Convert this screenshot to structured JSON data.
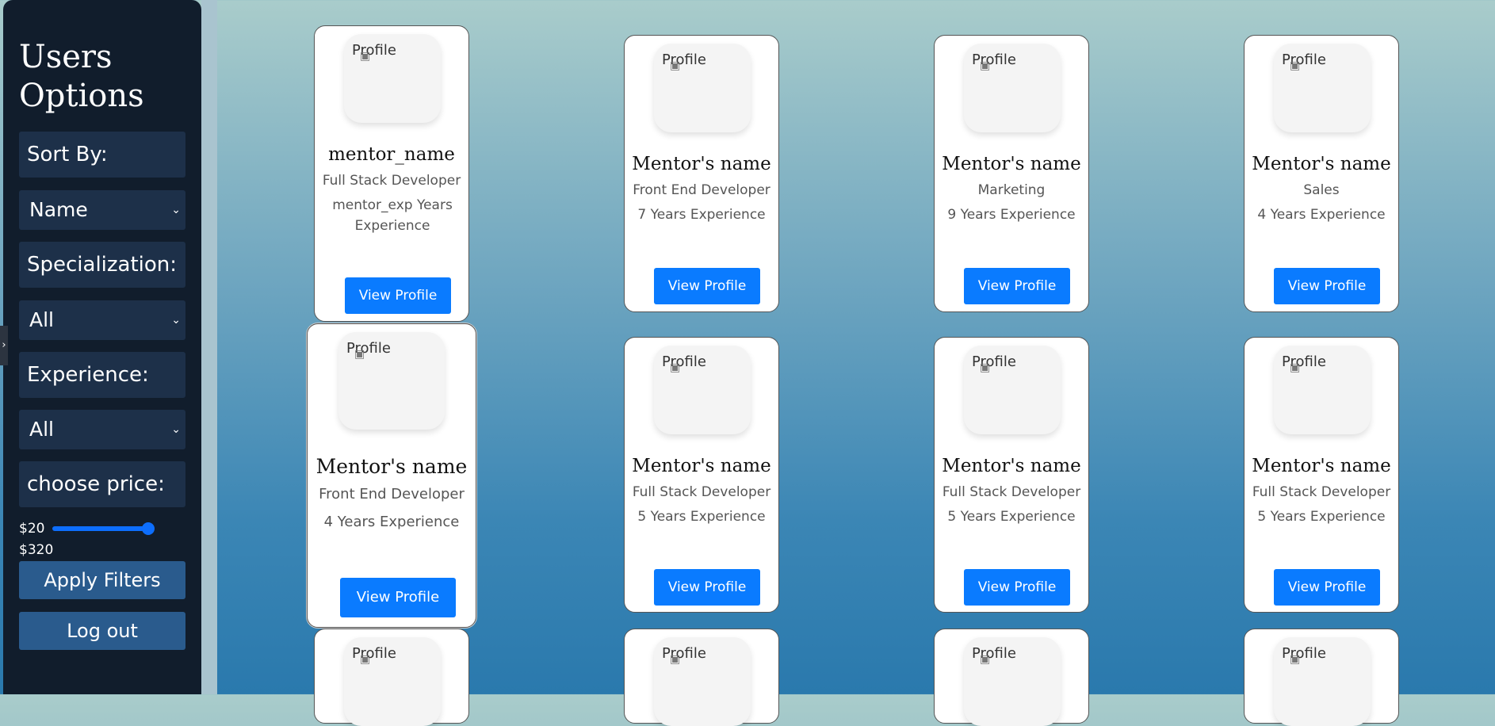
{
  "sidebar": {
    "title": "Users Options",
    "sort_label": "Sort By:",
    "sort_value": "Name",
    "specialization_label": "Specialization:",
    "specialization_value": "All",
    "experience_label": "Experience:",
    "experience_value": "All",
    "price_label": "choose price:",
    "price_min": "$20",
    "price_max": "$320",
    "apply_label": "Apply Filters",
    "logout_label": "Log out"
  },
  "icons": {
    "chevron": "chevron-down-icon",
    "broken_image": "broken-image-icon"
  },
  "colors": {
    "sidebar": "#111d2c",
    "field": "#1d3049",
    "button_dark": "#2a5b8d",
    "accent": "#0a7bff"
  },
  "cards": [
    {
      "alt": "Profile",
      "name": "mentor_name",
      "role": "Full Stack Developer",
      "exp": "mentor_exp Years Experience",
      "button": "View Profile"
    },
    {
      "alt": "Profile",
      "name": "Mentor's name",
      "role": "Front End Developer",
      "exp": "7 Years Experience",
      "button": "View Profile"
    },
    {
      "alt": "Profile",
      "name": "Mentor's name",
      "role": "Marketing",
      "exp": "9 Years Experience",
      "button": "View Profile"
    },
    {
      "alt": "Profile",
      "name": "Mentor's name",
      "role": "Sales",
      "exp": "4 Years Experience",
      "button": "View Profile"
    },
    {
      "alt": "Profile",
      "name": "Mentor's name",
      "role": "Front End Developer",
      "exp": "4 Years Experience",
      "button": "View Profile"
    },
    {
      "alt": "Profile",
      "name": "Mentor's name",
      "role": "Full Stack Developer",
      "exp": "5 Years Experience",
      "button": "View Profile"
    },
    {
      "alt": "Profile",
      "name": "Mentor's name",
      "role": "Full Stack Developer",
      "exp": "5 Years Experience",
      "button": "View Profile"
    },
    {
      "alt": "Profile",
      "name": "Mentor's name",
      "role": "Full Stack Developer",
      "exp": "5 Years Experience",
      "button": "View Profile"
    },
    {
      "alt": "Profile"
    },
    {
      "alt": "Profile"
    },
    {
      "alt": "Profile"
    },
    {
      "alt": "Profile"
    }
  ]
}
